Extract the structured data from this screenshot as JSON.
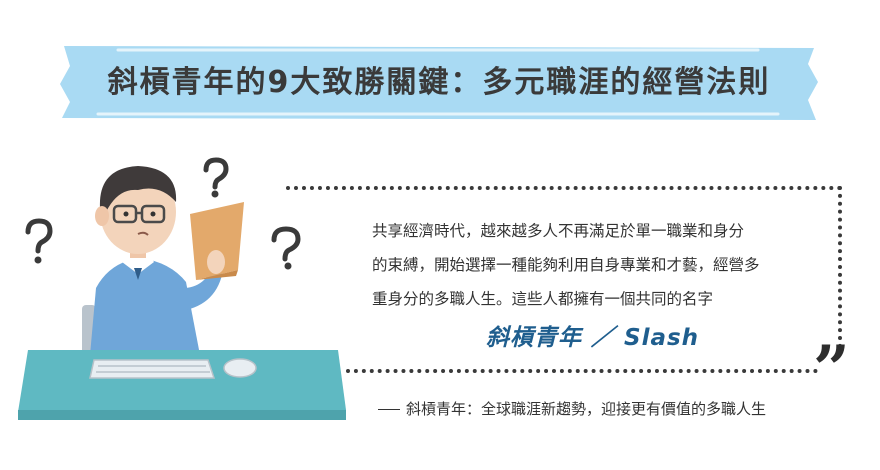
{
  "banner": {
    "title": "斜槓青年的9大致勝關鍵：多元職涯的經營法則",
    "color": "#a9daf3"
  },
  "quote": {
    "lines": [
      "共享經濟時代，越來越多人不再滿足於單一職業和身分",
      "的束縛，開始選擇一種能夠利用自身專業和才藝，經營多",
      "重身分的多職人生。這些人都擁有一個共同的名字"
    ],
    "heading": "斜槓青年 ／ Slash",
    "heading_color": "#1f5e8e",
    "close_mark": "”"
  },
  "source": {
    "text": "斜槓青年：全球職涯新趨勢，迎接更有價值的多職人生"
  },
  "illustration": {
    "icons": [
      "question-mark-icon",
      "question-mark-icon",
      "question-mark-icon"
    ],
    "shirt_color": "#6fa6d9",
    "desk_color": "#5fb9c2",
    "paper_color": "#e3a96b"
  }
}
